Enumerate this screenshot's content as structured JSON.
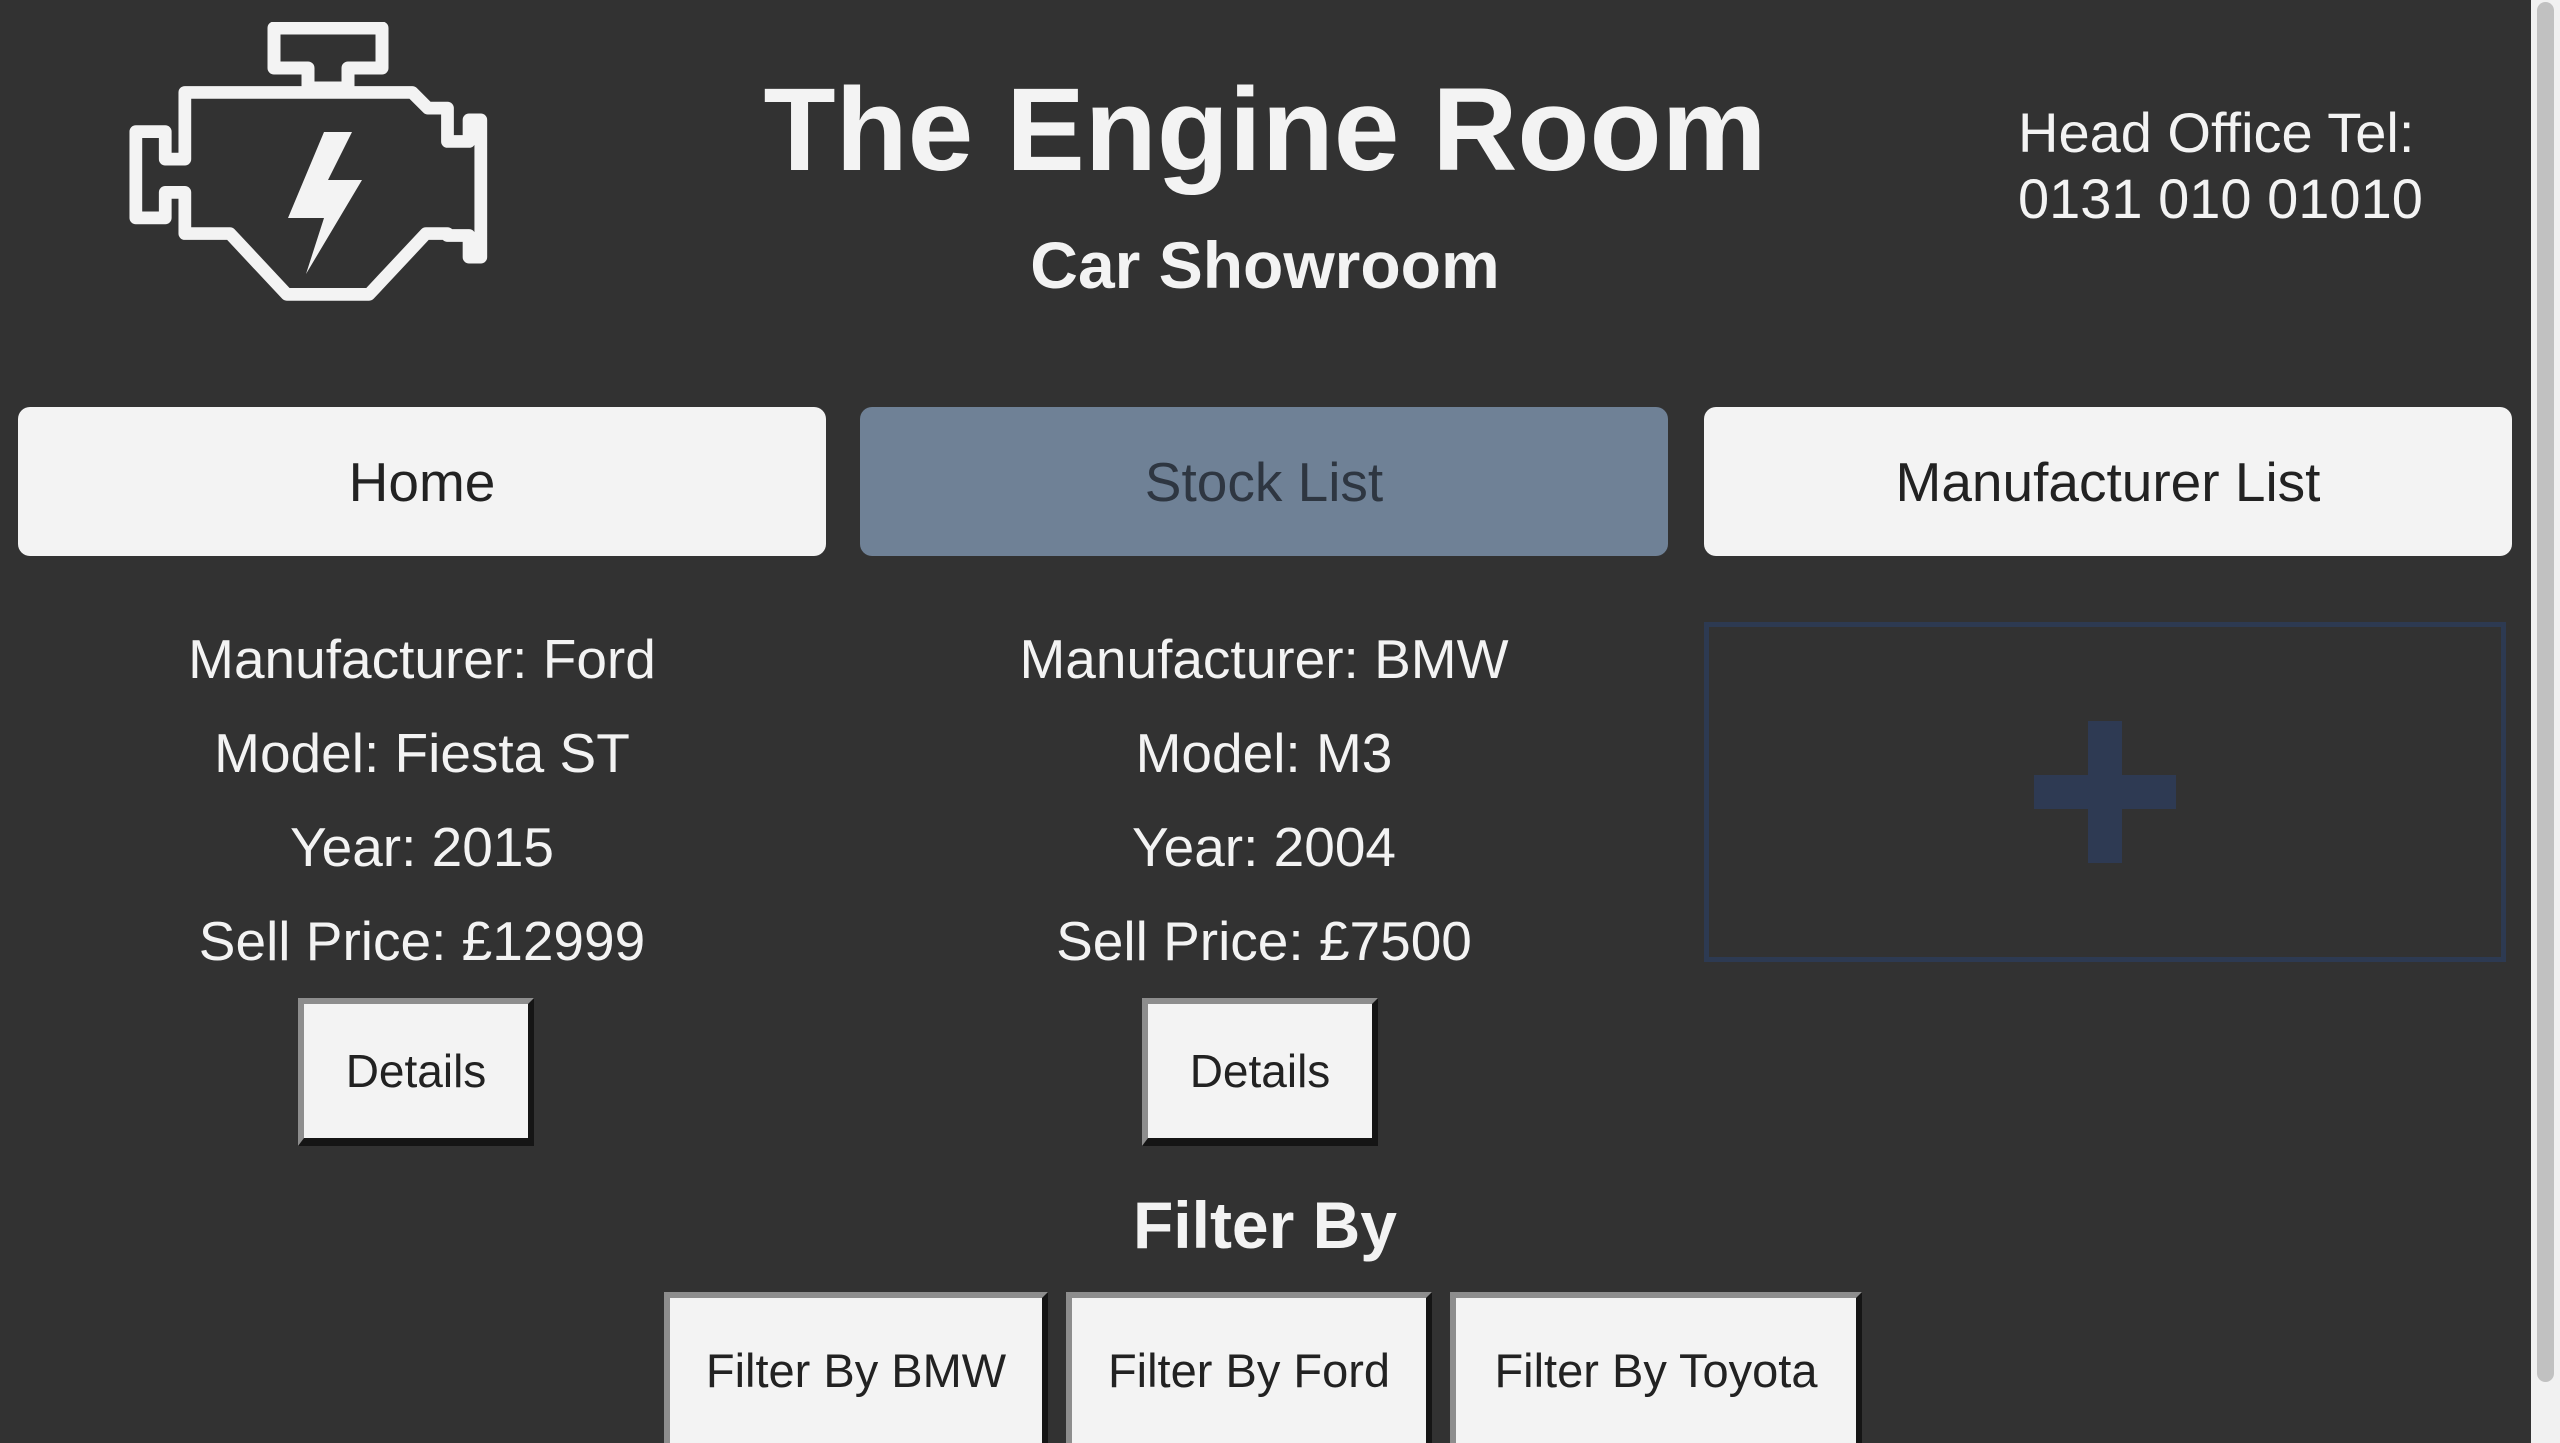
{
  "header": {
    "title": "The Engine Room",
    "subtitle": "Car Showroom",
    "contact_label": "Head Office Tel:",
    "contact_phone": "0131 010 01010",
    "logo_icon": "engine-icon"
  },
  "nav": {
    "items": [
      {
        "label": "Home",
        "active": false
      },
      {
        "label": "Stock List",
        "active": true
      },
      {
        "label": "Manufacturer List",
        "active": false
      }
    ]
  },
  "cars": [
    {
      "manufacturer": "Manufacturer: Ford",
      "model": "Model: Fiesta ST",
      "year": "Year: 2015",
      "price": "Sell Price: £12999",
      "details_label": "Details"
    },
    {
      "manufacturer": "Manufacturer: BMW",
      "model": "Model: M3",
      "year": "Year: 2004",
      "price": "Sell Price: £7500",
      "details_label": "Details"
    }
  ],
  "add_card": {
    "icon": "plus-icon"
  },
  "filter": {
    "title": "Filter By",
    "buttons": [
      {
        "label": "Filter By BMW"
      },
      {
        "label": "Filter By Ford"
      },
      {
        "label": "Filter By Toyota"
      }
    ]
  },
  "colors": {
    "background": "#323232",
    "text": "#f3f3f3",
    "button": "#f3f3f3",
    "active_tab": "#6f8196",
    "add_card_accent": "#2e3a53"
  }
}
